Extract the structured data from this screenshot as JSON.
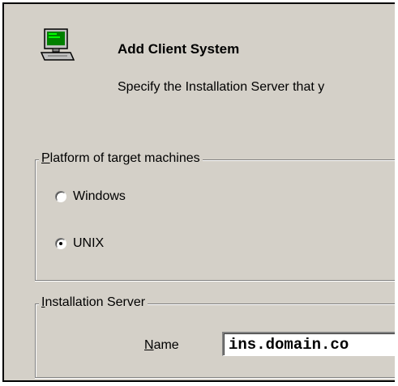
{
  "dialog": {
    "title": "Add Client System",
    "subtitle": "Specify the Installation Server that y",
    "icon": "computer-icon"
  },
  "platform_group": {
    "legend_mnemonic": "P",
    "legend_rest": "latform of target machines",
    "options": [
      {
        "label": "Windows",
        "checked": false
      },
      {
        "label": "UNIX",
        "checked": true
      }
    ]
  },
  "server_group": {
    "legend_mnemonic": "I",
    "legend_rest": "nstallation Server",
    "name_label_mnemonic": "N",
    "name_label_rest": "ame",
    "name_value": "ins.domain.co"
  },
  "colors": {
    "dialog_bg": "#d4d0c8",
    "monitor_screen": "#00c000"
  }
}
